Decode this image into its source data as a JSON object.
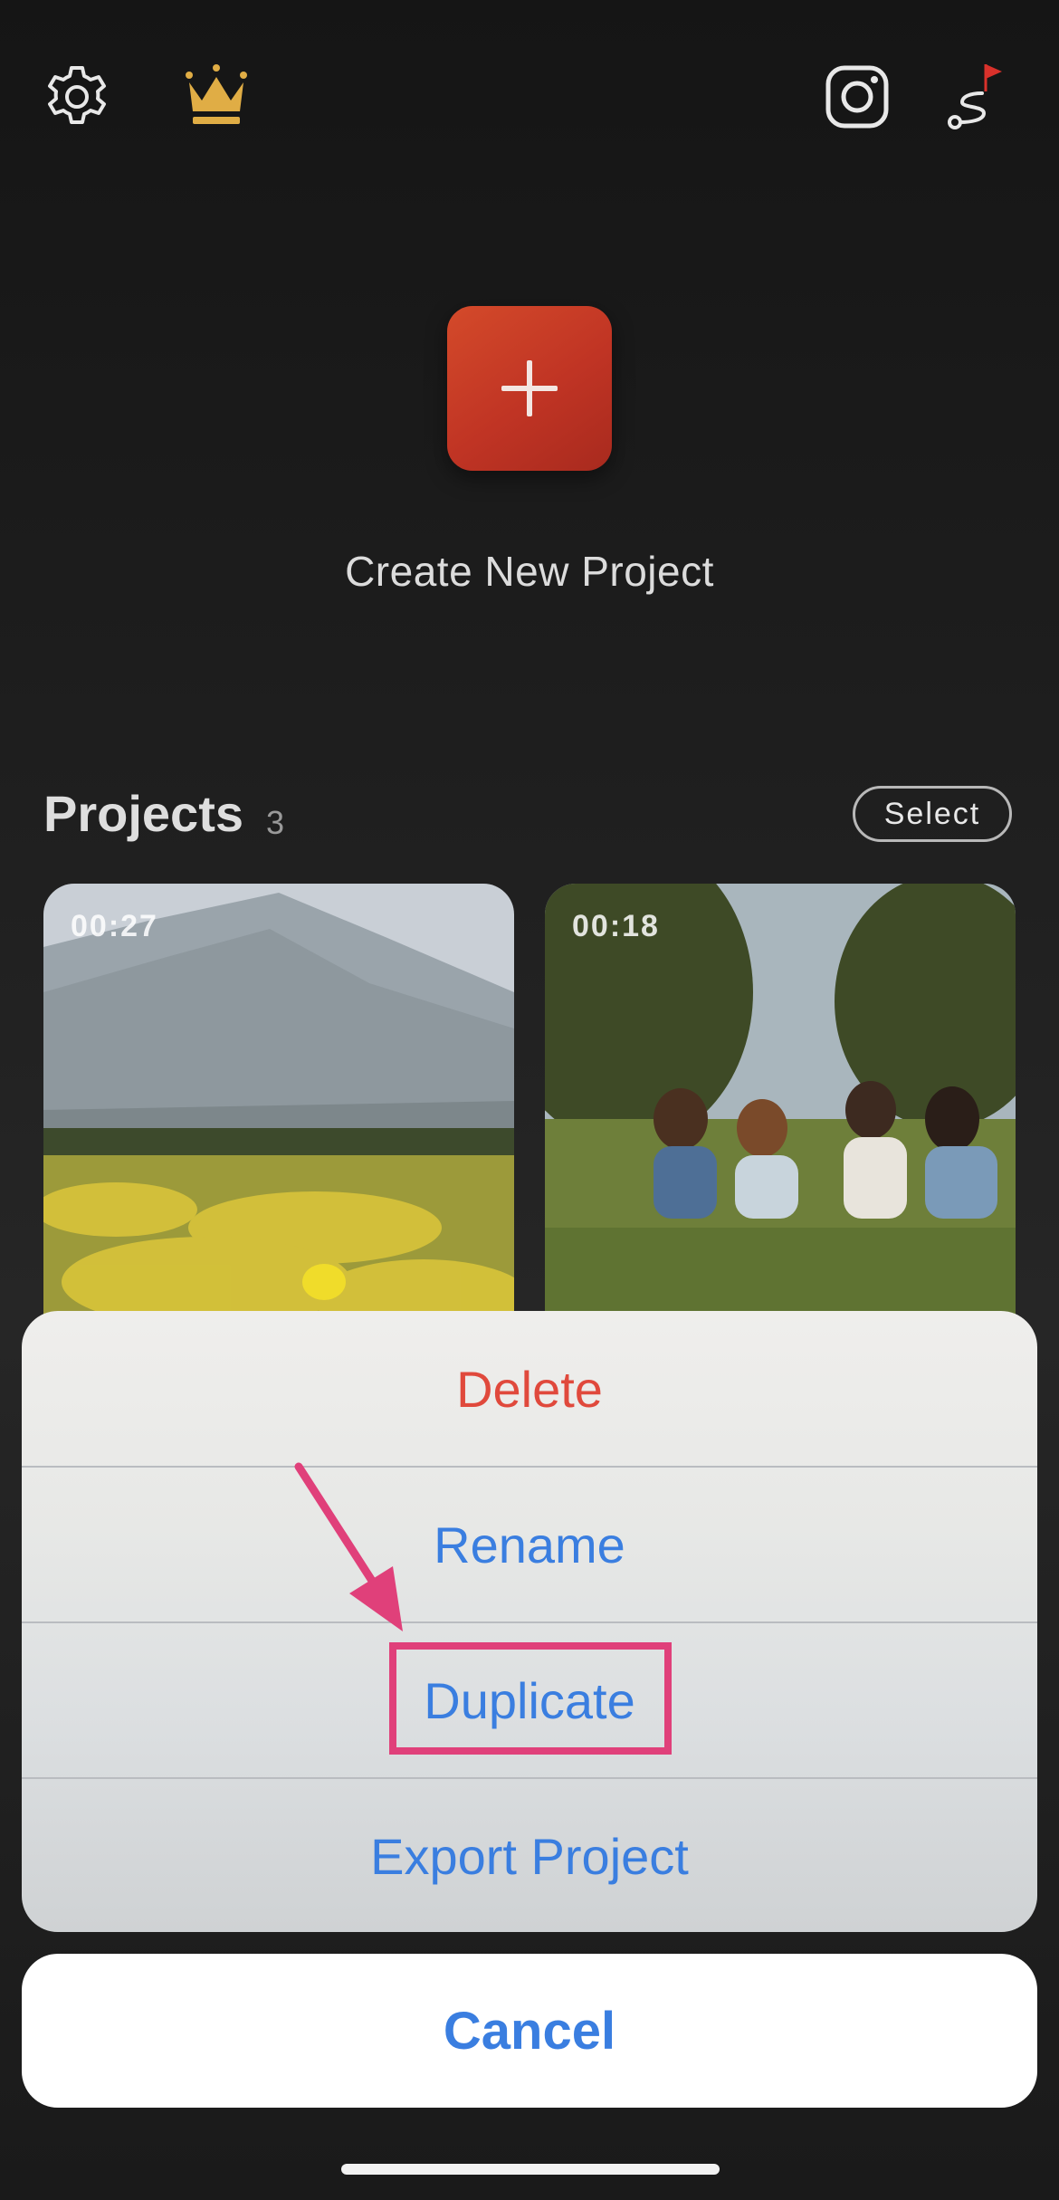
{
  "top_bar": {
    "icons": [
      "gear-icon",
      "crown-icon",
      "instagram-icon",
      "music-flag-icon"
    ],
    "crown_color": "#e0ad45",
    "flag_color": "#d9312b"
  },
  "create": {
    "label": "Create New Project",
    "button_color": "#c03424"
  },
  "projects": {
    "title": "Projects",
    "count": "3",
    "select_label": "Select",
    "items": [
      {
        "duration": "00:27",
        "image": "mountain-flower-field"
      },
      {
        "duration": "00:18",
        "image": "friends-on-grass"
      }
    ]
  },
  "action_sheet": {
    "items": [
      {
        "label": "Delete",
        "style": "destructive"
      },
      {
        "label": "Rename",
        "style": "default"
      },
      {
        "label": "Duplicate",
        "style": "default",
        "highlighted": true
      },
      {
        "label": "Export Project",
        "style": "default"
      }
    ],
    "cancel_label": "Cancel",
    "highlight_color": "#e0407a",
    "text_color": "#3a7ee0",
    "destructive_color": "#e0493c"
  }
}
